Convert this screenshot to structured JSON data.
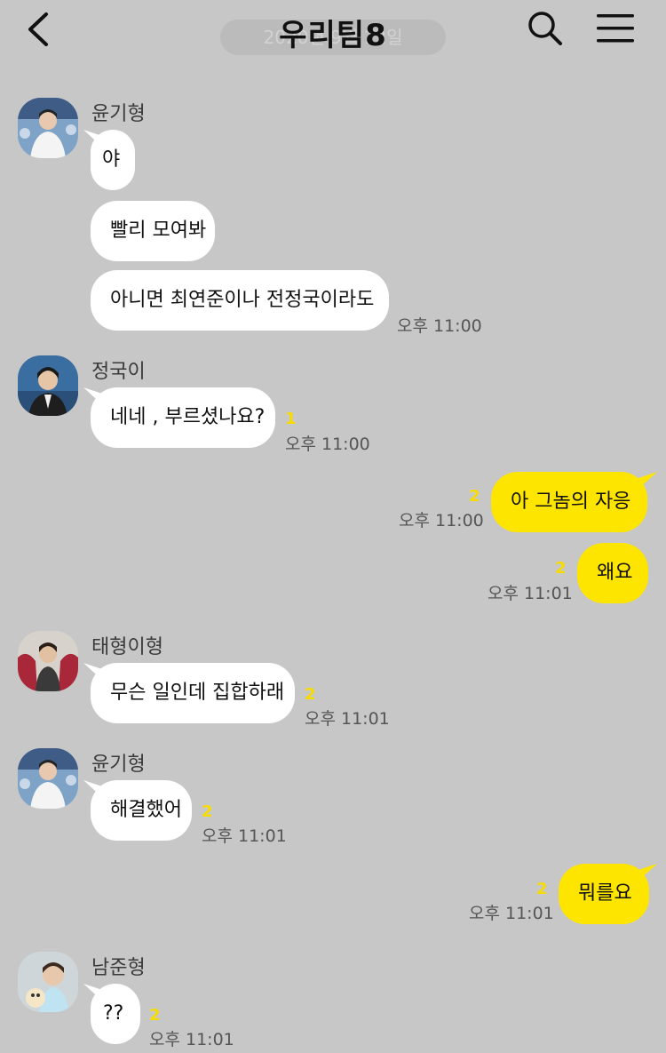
{
  "header": {
    "title": "우리팀",
    "member_count": "8",
    "date_overlay": "2020년 9월 12일",
    "back_icon": "chevron-left-icon",
    "search_icon": "search-icon",
    "menu_icon": "hamburger-menu-icon"
  },
  "colors": {
    "background": "#c7c7c7",
    "my_bubble": "#fee500",
    "their_bubble": "#ffffff",
    "unread_count": "#f7dc00"
  },
  "messages": [
    {
      "sender": "윤기형",
      "text": "야"
    },
    {
      "text": "빨리 모여봐"
    },
    {
      "text": "아니면 최연준이나 전정국이라도",
      "time": "오후 11:00"
    },
    {
      "sender": "정국이",
      "text": "네네 , 부르셨나요?",
      "unread": "1",
      "time": "오후 11:00"
    },
    {
      "mine": true,
      "text": "아 그놈의 자응",
      "unread": "2",
      "time": "오후 11:00"
    },
    {
      "mine": true,
      "text": "왜요",
      "unread": "2",
      "time": "오후 11:01"
    },
    {
      "sender": "태형이형",
      "text": "무슨 일인데 집합하래",
      "unread": "2",
      "time": "오후 11:01"
    },
    {
      "sender": "윤기형",
      "text": "해결했어",
      "unread": "2",
      "time": "오후 11:01"
    },
    {
      "mine": true,
      "text": "뭐를요",
      "unread": "2",
      "time": "오후 11:01"
    },
    {
      "sender": "남준형",
      "text": "??",
      "unread": "2",
      "time": "오후 11:01"
    }
  ]
}
